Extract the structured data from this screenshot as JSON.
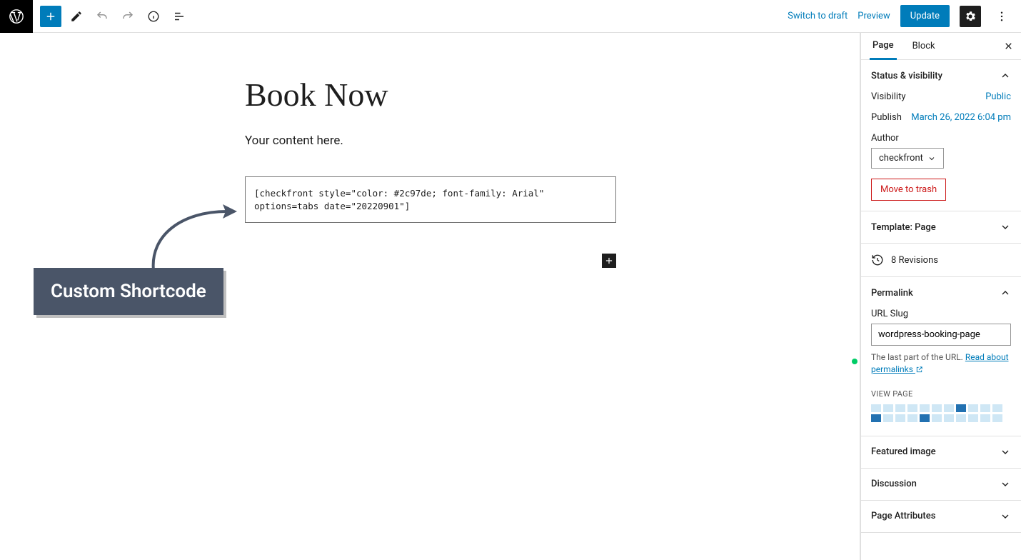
{
  "topbar": {
    "switch_to_draft": "Switch to draft",
    "preview": "Preview",
    "update": "Update"
  },
  "editor": {
    "title": "Book Now",
    "content": "Your content here.",
    "shortcode": "[checkfront style=\"color: #2c97de; font-family: Arial\" options=tabs date=\"20220901\"]"
  },
  "callout": {
    "label": "Custom Shortcode"
  },
  "sidebar": {
    "tabs": {
      "page": "Page",
      "block": "Block"
    },
    "panels": {
      "status": {
        "title": "Status & visibility",
        "visibility_label": "Visibility",
        "visibility_value": "Public",
        "publish_label": "Publish",
        "publish_value": "March 26, 2022 6:04 pm",
        "author_label": "Author",
        "author_value": "checkfront",
        "trash": "Move to trash"
      },
      "template": {
        "title": "Template: Page"
      },
      "revisions": {
        "count": "8 Revisions"
      },
      "permalink": {
        "title": "Permalink",
        "slug_label": "URL Slug",
        "slug_value": "wordpress-booking-page",
        "help_prefix": "The last part of the URL. ",
        "help_link": "Read about permalinks",
        "view_page": "View Page"
      },
      "featured": {
        "title": "Featured image"
      },
      "discussion": {
        "title": "Discussion"
      },
      "attributes": {
        "title": "Page Attributes"
      }
    }
  }
}
